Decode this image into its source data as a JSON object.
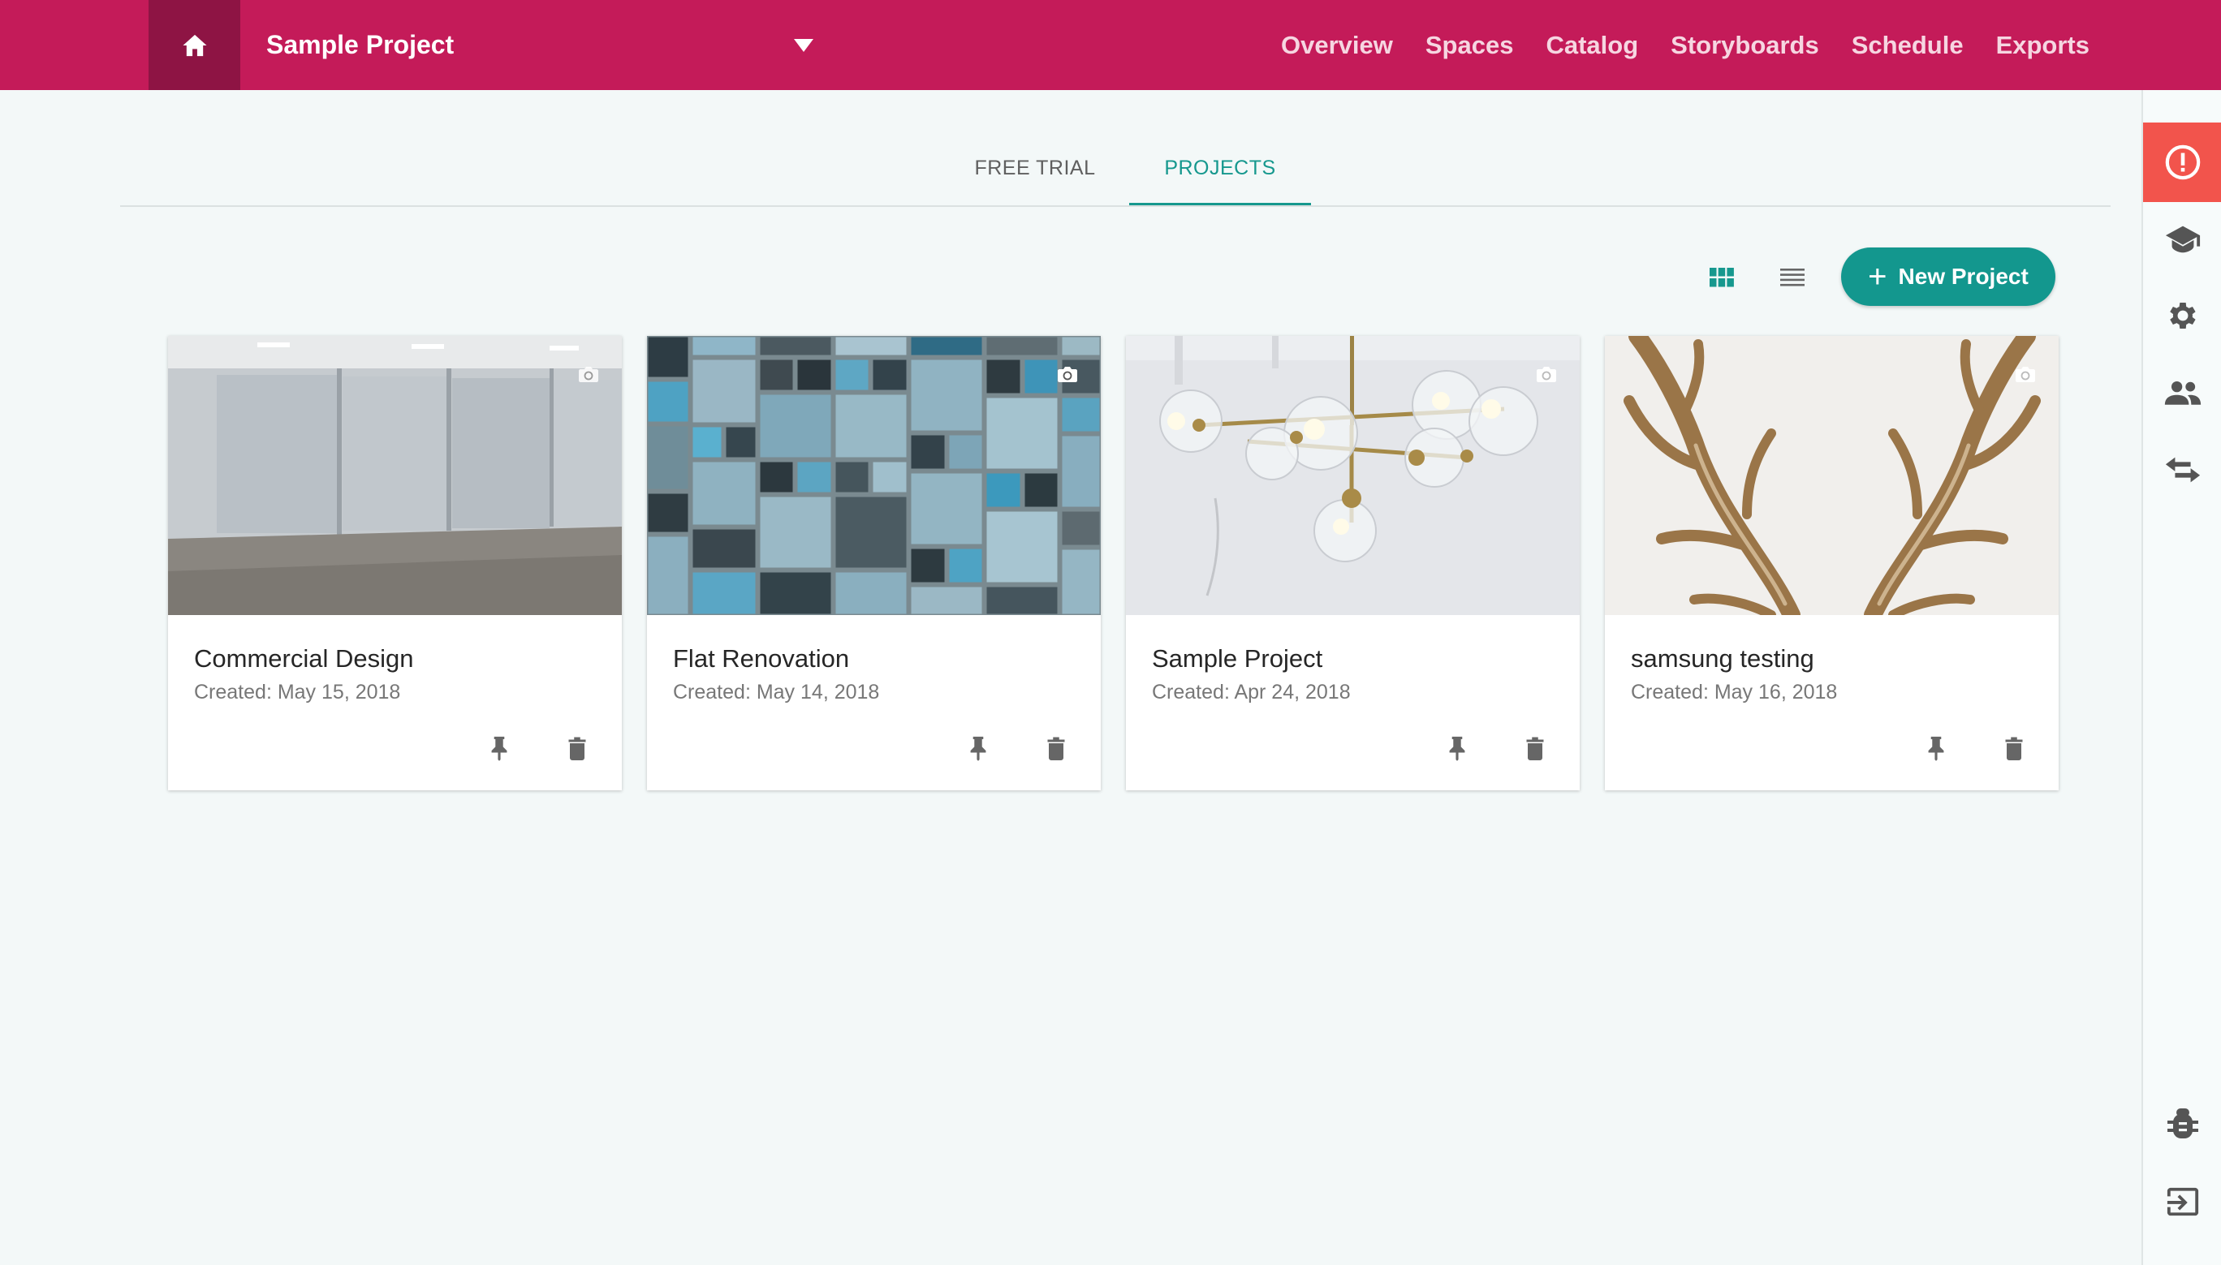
{
  "header": {
    "project_name": "Sample Project",
    "nav": [
      "Overview",
      "Spaces",
      "Catalog",
      "Storyboards",
      "Schedule",
      "Exports"
    ]
  },
  "tabs": [
    {
      "label": "FREE TRIAL",
      "active": false
    },
    {
      "label": "PROJECTS",
      "active": true
    }
  ],
  "toolbar": {
    "new_project_label": "New Project"
  },
  "projects": [
    {
      "title": "Commercial Design",
      "created": "Created: May 15, 2018"
    },
    {
      "title": "Flat Renovation",
      "created": "Created: May 14, 2018"
    },
    {
      "title": "Sample Project",
      "created": "Created: Apr 24, 2018"
    },
    {
      "title": "samsung testing",
      "created": "Created: May 16, 2018"
    }
  ],
  "colors": {
    "header": "#c41b59",
    "home": "#8e1444",
    "accent": "#16988e",
    "alert": "#f2544c"
  },
  "icons": {
    "rail": [
      "alert-icon",
      "graduation-cap-icon",
      "gear-icon",
      "people-icon",
      "swap-icon",
      "bug-icon",
      "logout-icon"
    ]
  }
}
